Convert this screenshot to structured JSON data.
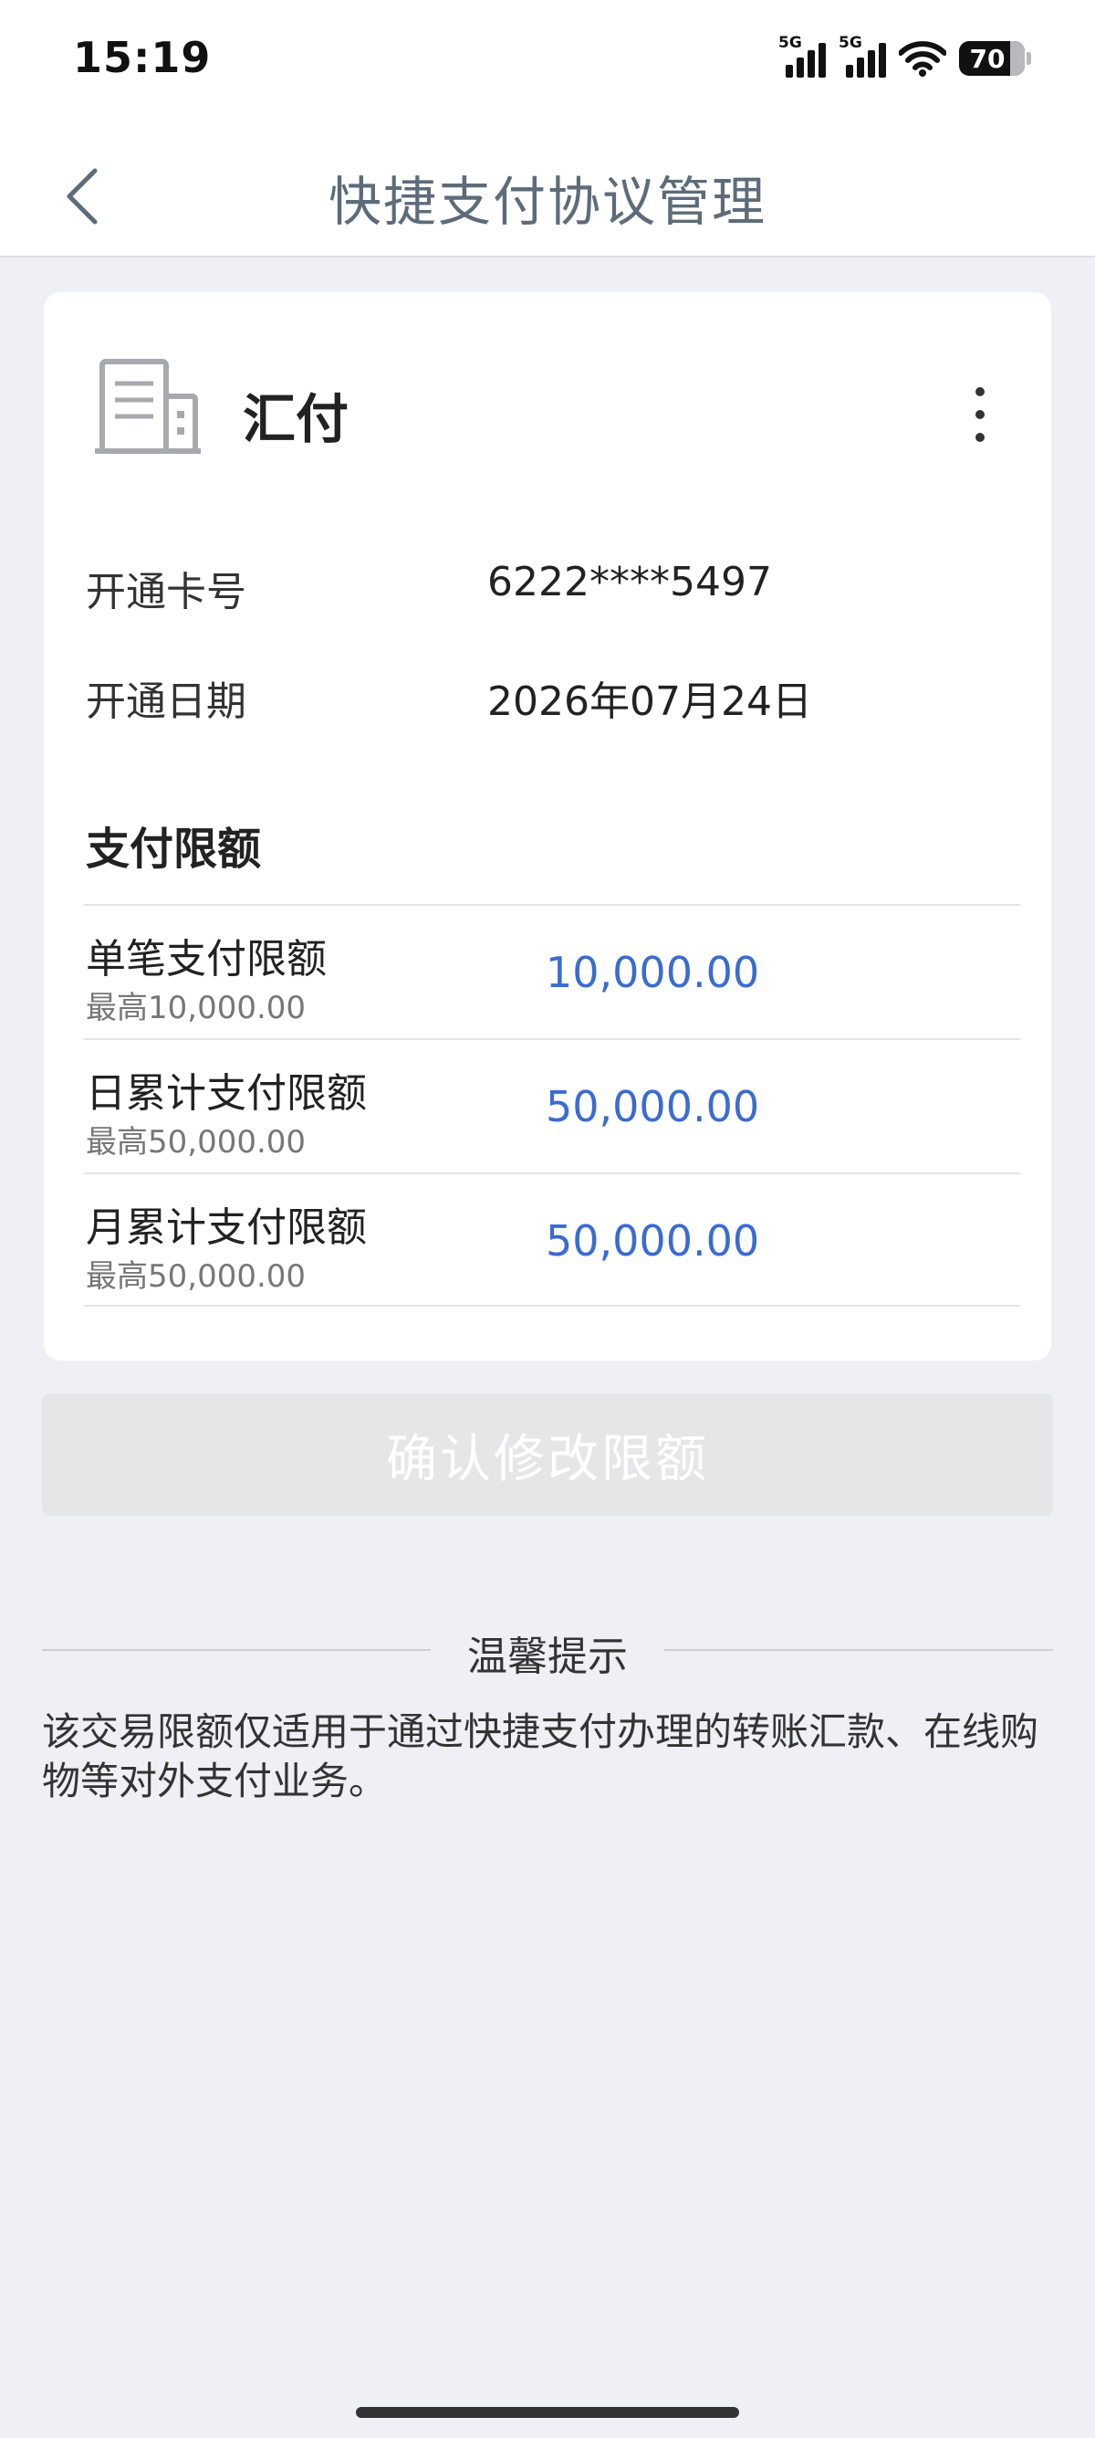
{
  "status_bar": {
    "time": "15:19",
    "signal1_label": "5G",
    "signal2_label": "5G",
    "battery_level": "70"
  },
  "nav": {
    "title": "快捷支付协议管理",
    "back_icon": "chevron-left-icon"
  },
  "merchant": {
    "name": "汇付",
    "icon": "building-icon",
    "more_icon": "more-vertical-icon"
  },
  "info": {
    "card_label": "开通卡号",
    "card_value": "6222****5497",
    "date_label": "开通日期",
    "date_value": "2026年07月24日"
  },
  "limits": {
    "section_title": "支付限额",
    "rows": [
      {
        "name": "单笔支付限额",
        "max": "最高10,000.00",
        "amount": "10,000.00"
      },
      {
        "name": "日累计支付限额",
        "max": "最高50,000.00",
        "amount": "50,000.00"
      },
      {
        "name": "月累计支付限额",
        "max": "最高50,000.00",
        "amount": "50,000.00"
      }
    ]
  },
  "confirm_button": "确认修改限额",
  "tips": {
    "title": "温馨提示",
    "text": "该交易限额仅适用于通过快捷支付办理的转账汇款、在线购物等对外支付业务。"
  },
  "colors": {
    "amount": "#3a6bd4",
    "nav_title": "#5d6b7a",
    "page_bg": "#eef0f5",
    "button_disabled": "#e6e6e8"
  }
}
